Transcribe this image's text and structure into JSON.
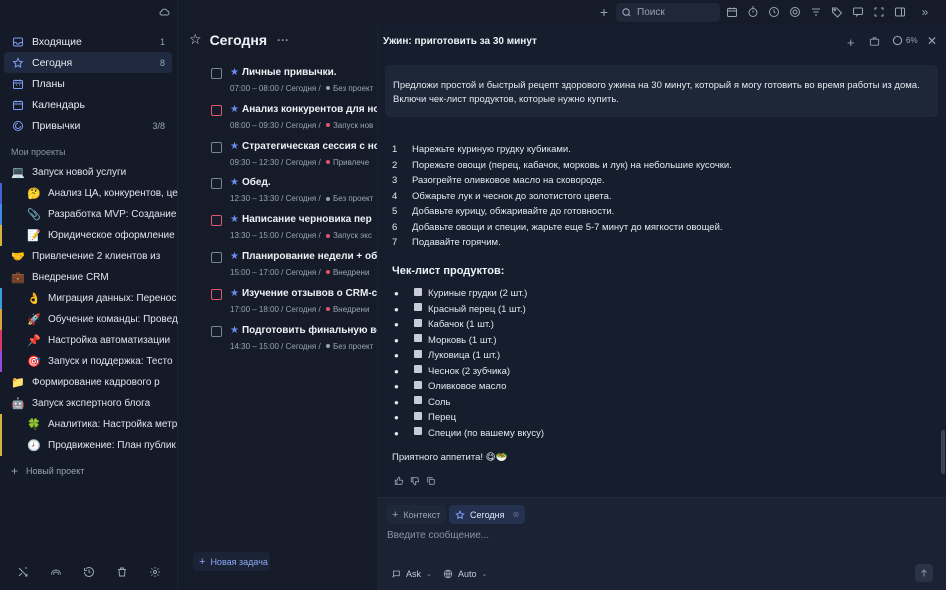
{
  "sidebar": {
    "nav": [
      {
        "label": "Входящие",
        "count": "1",
        "icon": "inbox-icon"
      },
      {
        "label": "Сегодня",
        "count": "8",
        "icon": "star-icon"
      },
      {
        "label": "Планы",
        "count": "",
        "icon": "calendar-grid-icon"
      },
      {
        "label": "Календарь",
        "count": "",
        "icon": "calendar-icon"
      },
      {
        "label": "Привычки",
        "count": "3/8",
        "icon": "habit-icon"
      }
    ],
    "projects_heading": "Мои проекты",
    "projects": [
      {
        "emoji": "💻",
        "label": "Запуск новой услуги",
        "level": 0,
        "color": ""
      },
      {
        "emoji": "🤔",
        "label": "Анализ ЦА, конкурентов, це",
        "level": 1,
        "color": "#4a5fd6"
      },
      {
        "emoji": "📎",
        "label": "Разработка MVP: Создание",
        "level": 1,
        "color": "#3d8ee0"
      },
      {
        "emoji": "📝",
        "label": "Юридическое оформление",
        "level": 1,
        "color": "#d6b43a"
      },
      {
        "emoji": "🤝",
        "label": "Привлечение 2 клиентов из",
        "level": 0,
        "color": ""
      },
      {
        "emoji": "💼",
        "label": "Внедрение CRM",
        "level": 0,
        "color": ""
      },
      {
        "emoji": "👌",
        "label": "Миграция данных: Перенос",
        "level": 1,
        "color": "#3aa0d6"
      },
      {
        "emoji": "🚀",
        "label": "Обучение команды: Провед",
        "level": 1,
        "color": "#d6a43a"
      },
      {
        "emoji": "📌",
        "label": "Настройка автоматизации",
        "level": 1,
        "color": "#d63a6a"
      },
      {
        "emoji": "🎯",
        "label": "Запуск и поддержка: Тесто",
        "level": 1,
        "color": "#9a4ad6"
      },
      {
        "emoji": "📁",
        "label": "Формирование кадрового р",
        "level": 0,
        "color": ""
      },
      {
        "emoji": "🤖",
        "label": "Запуск экспертного блога",
        "level": 0,
        "color": ""
      },
      {
        "emoji": "🍀",
        "label": "Аналитика: Настройка метр",
        "level": 1,
        "color": "#d6b43a"
      },
      {
        "emoji": "🕗",
        "label": "Продвижение: План публик",
        "level": 1,
        "color": "#d6b43a"
      }
    ],
    "new_project": "Новый проект"
  },
  "tasks": {
    "title": "Сегодня",
    "items": [
      {
        "name": "Личные привычки.",
        "time": "07:00 – 08:00 / Сегодня",
        "tag": "Без проект",
        "red": false,
        "tag_color": "#9aa3b5"
      },
      {
        "name": "Анализ конкурентов для нов",
        "time": "08:00 – 09:30 / Сегодня",
        "tag": "Запуск нов",
        "red": true,
        "tag_color": "#e2566e"
      },
      {
        "name": "Стратегическая сессия с нов",
        "time": "09:30 – 12:30 / Сегодня",
        "tag": "Привлече",
        "red": false,
        "tag_color": "#e2566e"
      },
      {
        "name": "Обед.",
        "time": "12:30 – 13:30 / Сегодня",
        "tag": "Без проект",
        "red": false,
        "tag_color": "#9aa3b5"
      },
      {
        "name": "Написание черновика пер",
        "time": "13:30 – 15:00 / Сегодня",
        "tag": "Запуск экс",
        "red": true,
        "tag_color": "#e2566e"
      },
      {
        "name": "Планирование недели + обе",
        "time": "15:00 – 17:00 / Сегодня",
        "tag": "Внедрени",
        "red": false,
        "tag_color": "#e2566e"
      },
      {
        "name": "Изучение отзывов о CRM-сис",
        "time": "17:00 – 18:00 / Сегодня",
        "tag": "Внедрени",
        "red": true,
        "tag_color": "#e2566e"
      },
      {
        "name": "Подготовить финальную верс",
        "time": "14:30 – 15:00 / Сегодня",
        "tag": "Без проект",
        "red": false,
        "tag_color": "#9aa3b5"
      }
    ],
    "new_task": "Новая задача"
  },
  "topbar": {
    "search_placeholder": "Поиск"
  },
  "chat": {
    "title": "Ужин: приготовить за 30 минут",
    "progress": "6%",
    "prompt_line1": "Предложи простой и быстрый рецепт здорового ужина на 30 минут, который я могу готовить во время работы из дома.",
    "prompt_line2": "Включи чек-лист продуктов, которые нужно купить.",
    "steps": [
      {
        "n": "1",
        "text": "Нарежьте куриную грудку кубиками."
      },
      {
        "n": "2",
        "text": "Порежьте овощи (перец, кабачок, морковь и лук) на небольшие кусочки."
      },
      {
        "n": "3",
        "text": "Разогрейте оливковое масло на сковороде."
      },
      {
        "n": "4",
        "text": "Обжарьте лук и чеснок до золотистого цвета."
      },
      {
        "n": "5",
        "text": "Добавьте курицу, обжаривайте до готовности."
      },
      {
        "n": "6",
        "text": "Добавьте овощи и специи, жарьте еще 5-7 минут до мягкости овощей."
      },
      {
        "n": "7",
        "text": "Подавайте горячим."
      }
    ],
    "checklist_title": "Чек-лист продуктов:",
    "checklist": [
      "Куриные грудки (2 шт.)",
      "Красный перец (1 шт.)",
      "Кабачок (1 шт.)",
      "Морковь (1 шт.)",
      "Луковица (1 шт.)",
      "Чеснок (2 зубчика)",
      "Оливковое масло",
      "Соль",
      "Перец",
      "Специи (по вашему вкусу)"
    ],
    "outro": "Приятного аппетита! 😋🥗",
    "composer": {
      "context_label": "Контекст",
      "today_label": "Сегодня",
      "placeholder": "Введите сообщение...",
      "mode_label": "Ask",
      "model_label": "Auto"
    }
  }
}
